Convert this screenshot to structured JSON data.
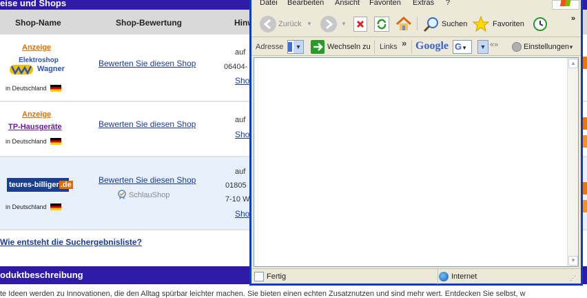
{
  "page": {
    "section_top": "eise und Shops",
    "columns": {
      "shop_name": "Shop-Name",
      "shop_rating": "Shop-Bewertung",
      "hint": "Hinw"
    },
    "rows": [
      {
        "ad_label": "Anzeige",
        "logo_line1": "Elektroshop",
        "logo_line2": "Wagner",
        "location": "in Deutschland",
        "rate_link": "Bewerten Sie diesen Shop",
        "hint_lines": [
          "auf",
          "06404-",
          "Sho"
        ]
      },
      {
        "ad_label": "Anzeige",
        "shop_name": "TP-Hausgeräte",
        "location": "in Deutschland",
        "rate_link": "Bewerten Sie diesen Shop",
        "hint_lines": [
          "auf",
          "Sho"
        ]
      },
      {
        "logo_text_a": "teures-",
        "logo_text_b": "billiger",
        "logo_text_c": ".de",
        "location": "in Deutschland",
        "rate_link": "Bewerten Sie diesen Shop",
        "badge": "SchlauShop",
        "hint_lines": [
          "auf",
          "01805",
          "7-10 W",
          "Sho"
        ]
      }
    ],
    "why_link": "Wie entsteht die Suchergebnisliste?",
    "section_bottom": "oduktbeschreibung",
    "footer_text": "te Ideen werden zu Innovationen, die den Alltag spürbar leichter machen. Sie bieten einen echten Zusatznutzen und sind mehr wert. Entdecken Sie selbst, w"
  },
  "ie": {
    "menu": [
      "Datei",
      "Bearbeiten",
      "Ansicht",
      "Favoriten",
      "Extras",
      "?"
    ],
    "toolbar": {
      "back": "Zurück",
      "search": "Suchen",
      "favorites": "Favoriten",
      "more": "»"
    },
    "address": {
      "label": "Adresse",
      "go": "Wechseln zu",
      "links": "Links",
      "more": "»",
      "google": "Google",
      "settings": "Einstellungen"
    },
    "status": {
      "text": "Fertig",
      "zone": "Internet"
    }
  },
  "colors": {
    "brand_bar": "#2f1aa8",
    "ad_orange": "#e07000",
    "link_blue": "#1a3b9a",
    "xp_blue": "#0b3dbd"
  }
}
